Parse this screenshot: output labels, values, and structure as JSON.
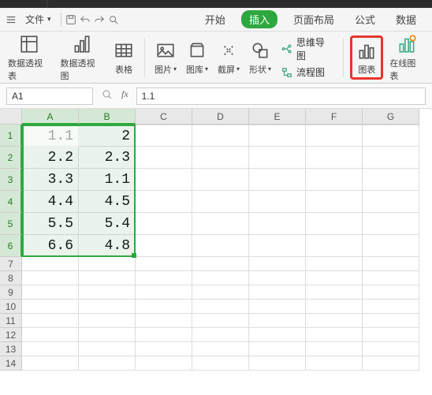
{
  "menubar": {
    "file": "文件",
    "tabs": [
      "开始",
      "插入",
      "页面布局",
      "公式",
      "数据"
    ],
    "active_tab_index": 1
  },
  "toolbar": {
    "items": [
      {
        "label": "数据透视表",
        "icon": "pivot-table"
      },
      {
        "label": "数据透视图",
        "icon": "pivot-chart"
      },
      {
        "label": "表格",
        "icon": "table"
      },
      {
        "label": "图片",
        "icon": "picture",
        "dropdown": true
      },
      {
        "label": "图库",
        "icon": "gallery",
        "dropdown": true
      },
      {
        "label": "截屏",
        "icon": "screenshot",
        "dropdown": true
      },
      {
        "label": "形状",
        "icon": "shapes",
        "dropdown": true
      }
    ],
    "small_items": [
      {
        "label": "思维导图",
        "icon": "mindmap"
      },
      {
        "label": "流程图",
        "icon": "flowchart"
      }
    ],
    "chart": {
      "label": "图表",
      "icon": "chart"
    },
    "online_chart": {
      "label": "在线图表",
      "icon": "online-chart"
    }
  },
  "refbar": {
    "name_box": "A1",
    "formula": "1.1"
  },
  "grid": {
    "columns": [
      "A",
      "B",
      "C",
      "D",
      "E",
      "F",
      "G"
    ],
    "selected_cols": [
      0,
      1
    ],
    "selected_rows": [
      0,
      1,
      2,
      3,
      4,
      5
    ],
    "rows": [
      [
        "1.1",
        "2",
        "",
        "",
        "",
        "",
        ""
      ],
      [
        "2.2",
        "2.3",
        "",
        "",
        "",
        "",
        ""
      ],
      [
        "3.3",
        "1.1",
        "",
        "",
        "",
        "",
        ""
      ],
      [
        "4.4",
        "4.5",
        "",
        "",
        "",
        "",
        ""
      ],
      [
        "5.5",
        "5.4",
        "",
        "",
        "",
        "",
        ""
      ],
      [
        "6.6",
        "4.8",
        "",
        "",
        "",
        "",
        ""
      ],
      [
        "",
        "",
        "",
        "",
        "",
        "",
        ""
      ],
      [
        "",
        "",
        "",
        "",
        "",
        "",
        ""
      ],
      [
        "",
        "",
        "",
        "",
        "",
        "",
        ""
      ],
      [
        "",
        "",
        "",
        "",
        "",
        "",
        ""
      ],
      [
        "",
        "",
        "",
        "",
        "",
        "",
        ""
      ],
      [
        "",
        "",
        "",
        "",
        "",
        "",
        ""
      ],
      [
        "",
        "",
        "",
        "",
        "",
        "",
        ""
      ],
      [
        "",
        "",
        "",
        "",
        "",
        "",
        ""
      ]
    ]
  }
}
